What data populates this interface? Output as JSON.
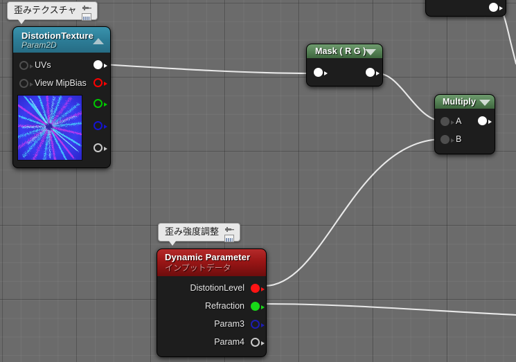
{
  "editor": {
    "name": "unreal-material-graph",
    "background_color": "#6b6b6b",
    "grid_minor_color": "#7a7a7a",
    "grid_major_color": "#4b4b4b"
  },
  "comments": [
    {
      "id": "comment-distortion-texture",
      "text": "歪みテクスチャ",
      "pin_icon": "pin-icon",
      "widget_icon": "keyboard-icon"
    },
    {
      "id": "comment-distortion-strength",
      "text": "歪み強度調整",
      "pin_icon": "pin-icon",
      "widget_icon": "keyboard-icon"
    }
  ],
  "nodes": {
    "texture_sample": {
      "title": "DistotionTexture",
      "subtitle": "Param2D",
      "header_color": "#2f7f99",
      "collapse_icon": "triangle-up-icon",
      "inputs": [
        {
          "label": "UVs",
          "pin_color": "#4e4e4e",
          "style": "hollow"
        },
        {
          "label": "View MipBias",
          "pin_color": "#4e4e4e",
          "style": "hollow"
        }
      ],
      "outputs": [
        {
          "label": "",
          "pin_color": "#ffffff",
          "style": "filled",
          "connected": true
        },
        {
          "label": "",
          "pin_color": "#ff0000",
          "style": "hollow",
          "connected": false
        },
        {
          "label": "",
          "pin_color": "#00c800",
          "style": "hollow",
          "connected": false
        },
        {
          "label": "",
          "pin_color": "#1414d2",
          "style": "hollow",
          "connected": false
        },
        {
          "label": "",
          "pin_color": "#c9c9c9",
          "style": "hollow",
          "connected": false
        }
      ],
      "thumbnail": "distortion-noise-texture"
    },
    "mask": {
      "title": "Mask ( R G )",
      "header_color": "#4f7f4f",
      "collapse_icon": "triangle-down-icon",
      "inputs": [
        {
          "label": "",
          "pin_color": "#ffffff",
          "style": "filled"
        }
      ],
      "outputs": [
        {
          "label": "",
          "pin_color": "#ffffff",
          "style": "filled"
        }
      ]
    },
    "multiply": {
      "title": "Multiply",
      "header_color": "#4f7f4f",
      "collapse_icon": "triangle-down-icon",
      "inputs": [
        {
          "label": "A",
          "pin_color": "#4e4e4e",
          "style": "filled"
        },
        {
          "label": "B",
          "pin_color": "#4e4e4e",
          "style": "filled"
        }
      ],
      "outputs": [
        {
          "label": "",
          "pin_color": "#ffffff",
          "style": "filled"
        }
      ]
    },
    "dynamic_parameter": {
      "title": "Dynamic Parameter",
      "subtitle": "インプットデータ",
      "header_color": "#9e1515",
      "outputs": [
        {
          "label": "DistotionLevel",
          "pin_color": "#ff1414",
          "style": "filled",
          "connected": true
        },
        {
          "label": "Refraction",
          "pin_color": "#18d818",
          "style": "filled",
          "connected": true
        },
        {
          "label": "Param3",
          "pin_color": "#1d1db4",
          "style": "hollow",
          "connected": false
        },
        {
          "label": "Param4",
          "pin_color": "#c9c9c9",
          "style": "hollow",
          "connected": false
        }
      ]
    },
    "offscreen_top": {
      "title": "",
      "outputs": [
        {
          "label": "",
          "pin_color": "#ffffff",
          "style": "filled",
          "connected": true
        }
      ]
    }
  },
  "wires": [
    {
      "from": "texture_sample.rgb",
      "to": "mask.input",
      "color": "#e8e8e8"
    },
    {
      "from": "mask.output",
      "to": "multiply.A",
      "color": "#e8e8e8"
    },
    {
      "from": "dynamic_parameter.DistotionLevel",
      "to": "multiply.B",
      "color": "#e8e8e8"
    },
    {
      "from": "dynamic_parameter.Refraction",
      "to": "offscreen",
      "color": "#e8e8e8"
    },
    {
      "from": "offscreen_top.output",
      "to": "offscreen",
      "color": "#e8e8e8"
    }
  ]
}
